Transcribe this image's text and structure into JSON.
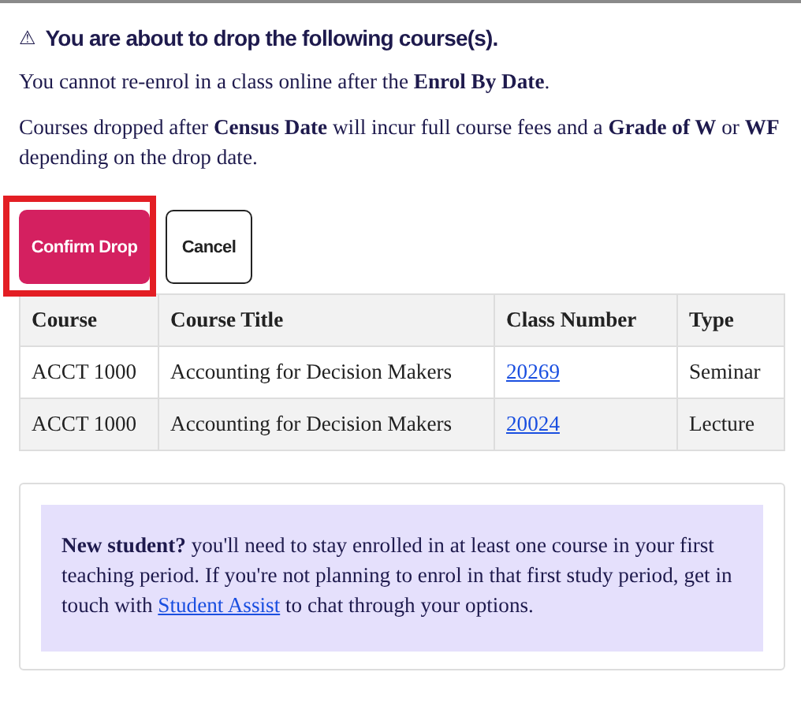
{
  "warning": {
    "icon": "⚠",
    "title": "You are about to drop the following course(s)."
  },
  "paragraphs": [
    "You cannot re-enrol in a class online after the **Enrol By Date**.",
    "Courses dropped after **Census Date** will incur full course fees and a **Grade of W** or **WF** depending on the drop date."
  ],
  "buttons": [
    {
      "label": "Confirm Drop",
      "kind": "primary",
      "highlighted": true
    },
    {
      "label": "Cancel",
      "kind": "secondary",
      "highlighted": false
    }
  ],
  "table": {
    "columns": [
      "Course",
      "Course Title",
      "Class Number",
      "Type"
    ],
    "rows": [
      [
        "ACCT 1000",
        "Accounting for Decision Makers",
        "20269",
        "Seminar"
      ],
      [
        "ACCT 1000",
        "Accounting for Decision Makers",
        "20024",
        "Lecture"
      ]
    ]
  },
  "note": {
    "before": "**New student?** you'll need to stay enrolled in at least one course in your first teaching period. If you're not planning to enrol in that first study period, get in touch with",
    "link": "Student Assist",
    "after": "to chat through your options."
  }
}
